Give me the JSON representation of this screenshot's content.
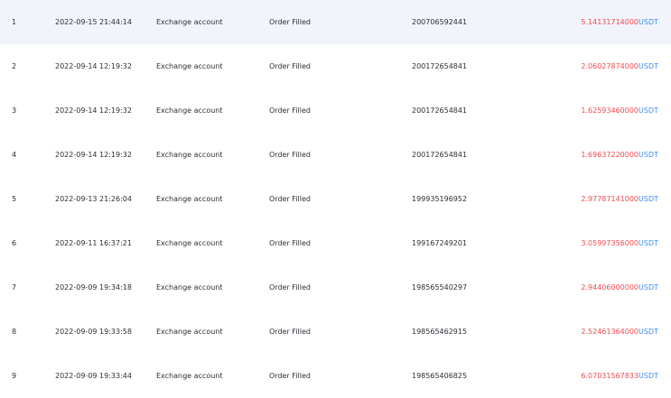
{
  "rows": [
    {
      "index": "1",
      "time": "2022-09-15 21:44:14",
      "account": "Exchange account",
      "type": "Order Filled",
      "order_id": "200706592441",
      "amount": "5.14131714000",
      "unit": "USDT"
    },
    {
      "index": "2",
      "time": "2022-09-14 12:19:32",
      "account": "Exchange account",
      "type": "Order Filled",
      "order_id": "200172654841",
      "amount": "2.06027874000",
      "unit": "USDT"
    },
    {
      "index": "3",
      "time": "2022-09-14 12:19:32",
      "account": "Exchange account",
      "type": "Order Filled",
      "order_id": "200172654841",
      "amount": "1.62593460000",
      "unit": "USDT"
    },
    {
      "index": "4",
      "time": "2022-09-14 12:19:32",
      "account": "Exchange account",
      "type": "Order Filled",
      "order_id": "200172654841",
      "amount": "1.69637220000",
      "unit": "USDT"
    },
    {
      "index": "5",
      "time": "2022-09-13 21:26:04",
      "account": "Exchange account",
      "type": "Order Filled",
      "order_id": "199935196952",
      "amount": "2.97787141000",
      "unit": "USDT"
    },
    {
      "index": "6",
      "time": "2022-09-11 16:37:21",
      "account": "Exchange account",
      "type": "Order Filled",
      "order_id": "199167249201",
      "amount": "3.05997356000",
      "unit": "USDT"
    },
    {
      "index": "7",
      "time": "2022-09-09 19:34:18",
      "account": "Exchange account",
      "type": "Order Filled",
      "order_id": "198565540297",
      "amount": "2.94406000000",
      "unit": "USDT"
    },
    {
      "index": "8",
      "time": "2022-09-09 19:33:58",
      "account": "Exchange account",
      "type": "Order Filled",
      "order_id": "198565462915",
      "amount": "2.52461364000",
      "unit": "USDT"
    },
    {
      "index": "9",
      "time": "2022-09-09 19:33:44",
      "account": "Exchange account",
      "type": "Order Filled",
      "order_id": "198565406825",
      "amount": "6.07031567833",
      "unit": "USDT"
    }
  ],
  "colors": {
    "amount": "#f2494f",
    "unit": "#3d8df2",
    "highlight_row": "#f1f4fb"
  }
}
